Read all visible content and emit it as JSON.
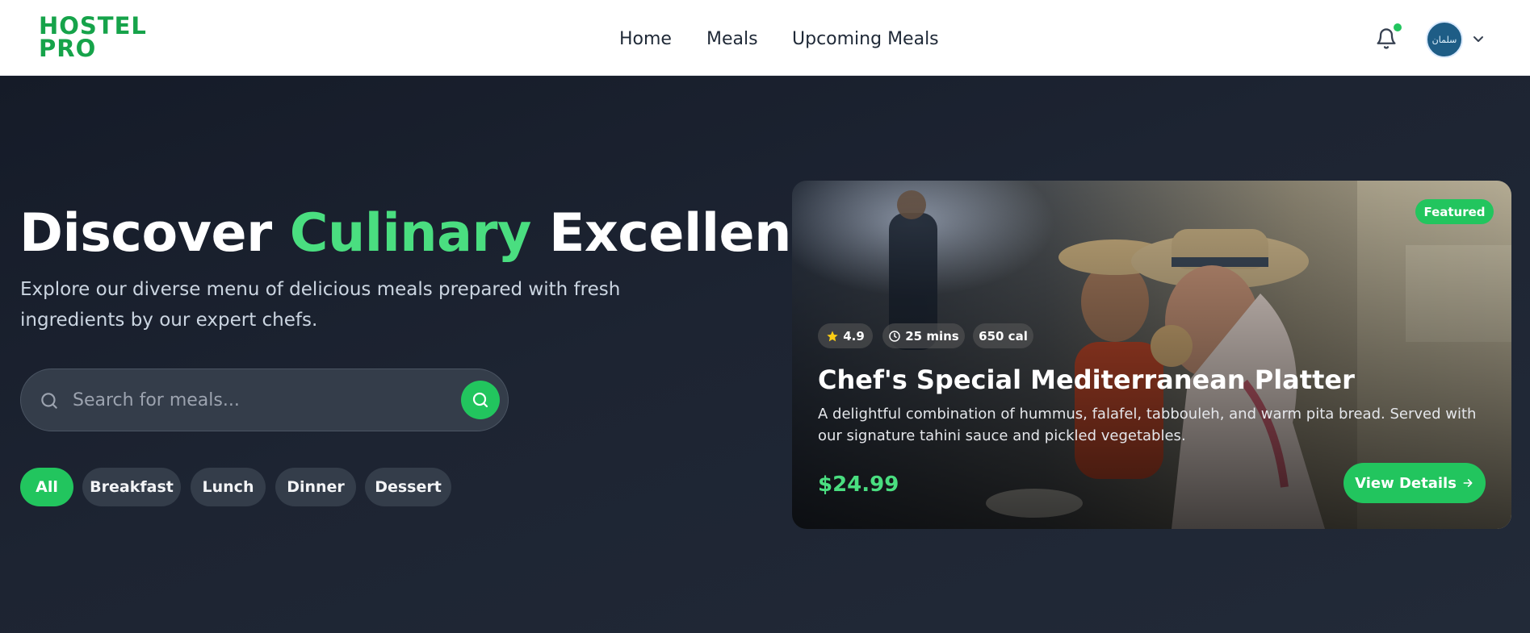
{
  "brand": {
    "line1": "HOSTEL",
    "line2": "PRO",
    "color": "#16a34a"
  },
  "nav": {
    "links": [
      {
        "label": "Home"
      },
      {
        "label": "Meals"
      },
      {
        "label": "Upcoming Meals"
      }
    ],
    "notifications_icon": "bell-icon",
    "has_unread_notifications": true,
    "avatar_text": "سلمان",
    "menu_icon": "chevron-down-icon"
  },
  "hero": {
    "headline_part1": "Discover",
    "headline_accent": "Culinary",
    "headline_part2": "Excellence",
    "subtext": "Explore our diverse menu of delicious meals prepared with fresh ingredients by our expert chefs.",
    "search": {
      "placeholder": "Search for meals...",
      "value": ""
    },
    "categories": [
      {
        "label": "All",
        "active": true
      },
      {
        "label": "Breakfast",
        "active": false
      },
      {
        "label": "Lunch",
        "active": false
      },
      {
        "label": "Dinner",
        "active": false
      },
      {
        "label": "Dessert",
        "active": false
      }
    ]
  },
  "featured": {
    "badge": "Featured",
    "rating": "4.9",
    "time": "25 mins",
    "calories": "650 cal",
    "title": "Chef's Special Mediterranean Platter",
    "description": "A delightful combination of hummus, falafel, tabbouleh, and warm pita bread. Served with our signature tahini sauce and pickled vegetables.",
    "price": "$24.99",
    "cta": "View Details"
  },
  "colors": {
    "accent": "#22c55e",
    "accent_light": "#4ade80",
    "hero_bg": "#1d2432",
    "chip_bg": "#343d4a"
  }
}
